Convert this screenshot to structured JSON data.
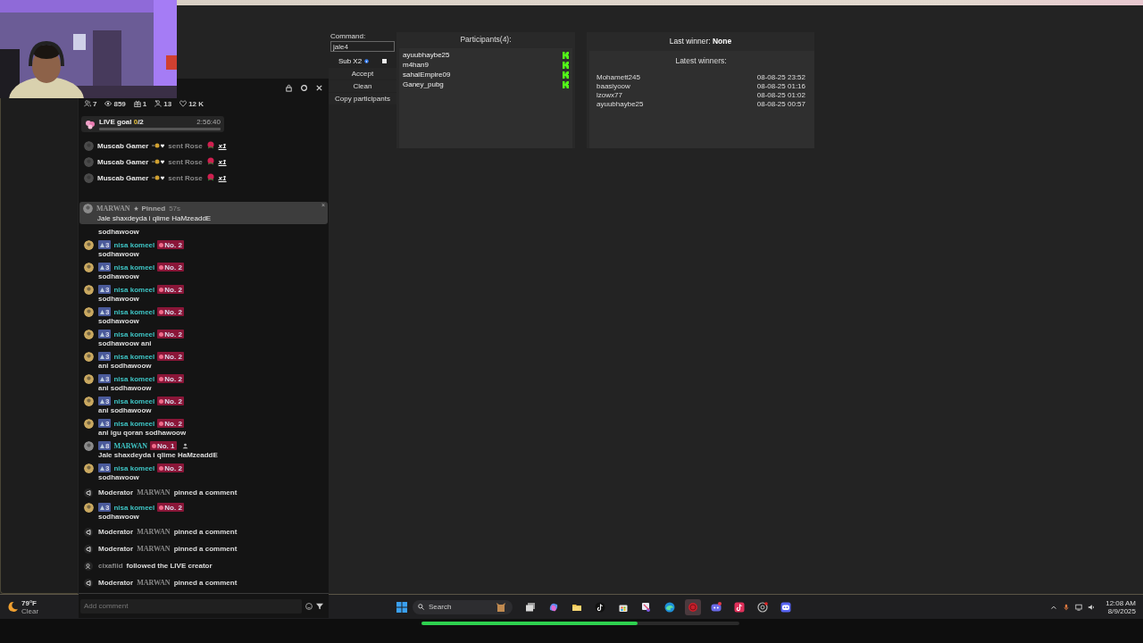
{
  "side_pane": {
    "kind": "panel"
  },
  "chat": {
    "stats": [
      {
        "kind": "members",
        "value": "7"
      },
      {
        "kind": "viewers",
        "value": "859"
      },
      {
        "kind": "gifts",
        "value": "1"
      },
      {
        "kind": "followers",
        "value": "13"
      },
      {
        "kind": "likes",
        "value": "12 K"
      }
    ],
    "live_goal": {
      "label": "LIVE goal",
      "current": "0",
      "total": "/2",
      "timer": "2:56:40",
      "level": 0
    },
    "gifts": [
      {
        "user": "Muscab Gamer",
        "action": "sent Rose",
        "count": "x1"
      },
      {
        "user": "Muscab Gamer",
        "action": "sent Rose",
        "count": "x1"
      },
      {
        "user": "Muscab Gamer",
        "action": "sent Rose",
        "count": "x1"
      }
    ],
    "pinned": {
      "user": "MARWAN",
      "tag": "Pinned",
      "age": "57s",
      "text": "Jale shaxdeyda i qlime HaMzeaddE",
      "close": "×"
    },
    "messages": [
      {
        "kind": "continued",
        "text": "sodhawoow"
      },
      {
        "kind": "comment",
        "fan_level": "3",
        "user": "nisa komeel",
        "rank": "No. 2",
        "text": "sodhawoow"
      },
      {
        "kind": "comment",
        "fan_level": "3",
        "user": "nisa komeel",
        "rank": "No. 2",
        "text": "sodhawoow"
      },
      {
        "kind": "comment",
        "fan_level": "3",
        "user": "nisa komeel",
        "rank": "No. 2",
        "text": "sodhawoow"
      },
      {
        "kind": "comment",
        "fan_level": "3",
        "user": "nisa komeel",
        "rank": "No. 2",
        "text": "sodhawoow"
      },
      {
        "kind": "comment",
        "fan_level": "3",
        "user": "nisa komeel",
        "rank": "No. 2",
        "text": "sodhawoow ani"
      },
      {
        "kind": "comment",
        "fan_level": "3",
        "user": "nisa komeel",
        "rank": "No. 2",
        "text": "ani sodhawoow"
      },
      {
        "kind": "comment",
        "fan_level": "3",
        "user": "nisa komeel",
        "rank": "No. 2",
        "text": "ani sodhawoow"
      },
      {
        "kind": "comment",
        "fan_level": "3",
        "user": "nisa komeel",
        "rank": "No. 2",
        "text": "ani sodhawoow"
      },
      {
        "kind": "comment",
        "fan_level": "3",
        "user": "nisa komeel",
        "rank": "No. 2",
        "text": "ani igu qoran sodhawoow"
      },
      {
        "kind": "comment",
        "fan_level": "8",
        "user": "MARWAN",
        "rank": "No. 1",
        "moderator": true,
        "text": "Jale shaxdeyda i qlime HaMzeaddE"
      },
      {
        "kind": "comment",
        "fan_level": "3",
        "user": "nisa komeel",
        "rank": "No. 2",
        "text": "sodhawoow"
      },
      {
        "kind": "pin",
        "role": "Moderator",
        "user": "MARWAN",
        "text": "pinned a comment"
      },
      {
        "kind": "comment",
        "fan_level": "3",
        "user": "nisa komeel",
        "rank": "No. 2",
        "text": "sodhawoow"
      },
      {
        "kind": "pin",
        "role": "Moderator",
        "user": "MARWAN",
        "text": "pinned a comment"
      },
      {
        "kind": "pin",
        "role": "Moderator",
        "user": "MARWAN",
        "text": "pinned a comment"
      },
      {
        "kind": "follow",
        "user": "cixafiid",
        "text": "followed the LIVE creator"
      },
      {
        "kind": "pin",
        "role": "Moderator",
        "user": "MARWAN",
        "text": "pinned a comment"
      }
    ],
    "comment_field": {
      "placeholder": "Add comment"
    }
  },
  "giveaway": {
    "command_label": "Command:",
    "command_value": "jale4",
    "sub": {
      "label": "Sub X2",
      "checked": false
    },
    "buttons": [
      "Accept",
      "Clean",
      "Copy participants"
    ],
    "participants_title": "Participants(4):",
    "participants": [
      "ayuubhaybe25",
      "m4han9",
      "sahalEmpire09",
      "Ganey_pubg"
    ],
    "last_winner_label": "Last winner:",
    "last_winner": "None",
    "latest_title": "Latest winners:",
    "winners": [
      {
        "name": "Mohamett245",
        "date": "08-08-25 23:52"
      },
      {
        "name": "baasiyoow",
        "date": "08-08-25 01:16"
      },
      {
        "name": "lzowx77",
        "date": "08-08-25 01:02"
      },
      {
        "name": "ayuubhaybe25",
        "date": "08-08-25 00:57"
      }
    ]
  },
  "taskbar": {
    "weather": {
      "temp": "79°F",
      "condition": "Clear"
    },
    "search": {
      "placeholder": "Search"
    },
    "apps": [
      {
        "kind": "taskview",
        "selected": false
      },
      {
        "kind": "copilot",
        "selected": false
      },
      {
        "kind": "files",
        "selected": false
      },
      {
        "kind": "tiktok",
        "selected": false
      },
      {
        "kind": "store",
        "selected": false
      },
      {
        "kind": "snip",
        "selected": false
      },
      {
        "kind": "edge",
        "selected": false
      },
      {
        "kind": "record",
        "selected": true
      },
      {
        "kind": "discord",
        "selected": false
      },
      {
        "kind": "tiktok_live",
        "selected": false
      },
      {
        "kind": "chrome",
        "selected": false
      },
      {
        "kind": "discord_alt",
        "selected": false
      }
    ],
    "clock": {
      "time": "12:08 AM",
      "date": "8/9/2025"
    }
  },
  "progress": {
    "level": 0.68
  }
}
